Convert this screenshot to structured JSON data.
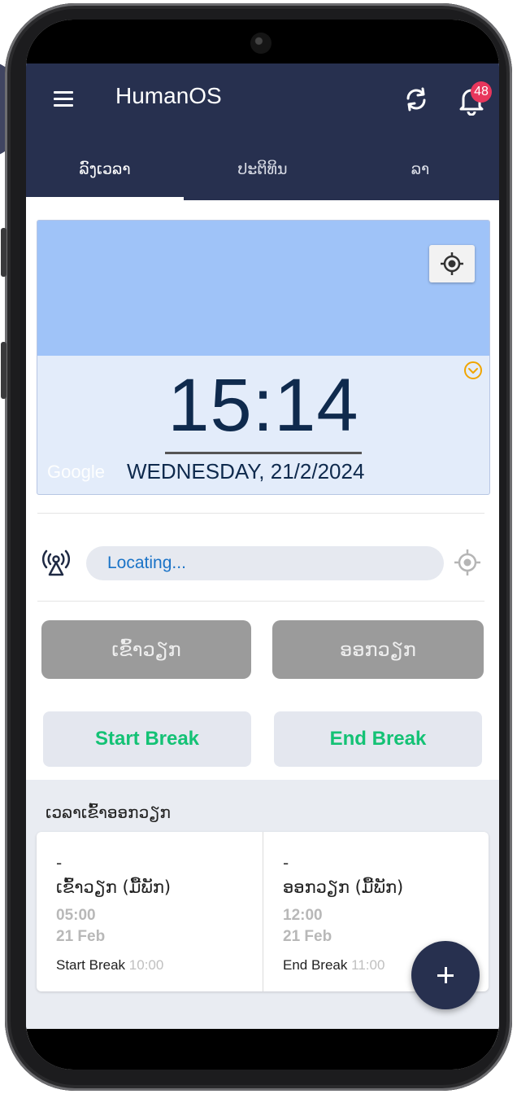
{
  "app": {
    "title": "HumanOS",
    "notification_count": "48"
  },
  "tabs": [
    {
      "label": "ລົງເວລາ",
      "active": true
    },
    {
      "label": "ປະຕິທິນ",
      "active": false
    },
    {
      "label": "ລາ",
      "active": false
    }
  ],
  "clock": {
    "time": "15:14",
    "date": "WEDNESDAY, 21/2/2024",
    "map_attribution": "Google"
  },
  "location": {
    "status": "Locating..."
  },
  "buttons": {
    "check_in": "ເຂົ້າວຽກ",
    "check_out": "ອອກວຽກ",
    "start_break": "Start Break",
    "end_break": "End Break"
  },
  "history": {
    "title": "ເວລາເຂົ້າອອກວຽກ",
    "records": [
      {
        "dash": "-",
        "type": "ເຂົ້າວຽກ (ມື້ພັກ)",
        "time": "05:00",
        "date": "21 Feb",
        "break_label": "Start Break",
        "break_time": "10:00"
      },
      {
        "dash": "-",
        "type": "ອອກວຽກ (ມື້ພັກ)",
        "time": "12:00",
        "date": "21 Feb",
        "break_label": "End Break",
        "break_time": "11:00"
      }
    ]
  },
  "colors": {
    "primary": "#27304f",
    "badge": "#e8365c",
    "break_text": "#14c275",
    "locating_text": "#1a73c7",
    "map_blue": "#9fc3f8"
  },
  "icons": [
    "menu-icon",
    "sync-icon",
    "bell-icon",
    "gps-target-icon",
    "chevron-down-circle-icon",
    "signal-tower-icon",
    "plus-icon"
  ]
}
